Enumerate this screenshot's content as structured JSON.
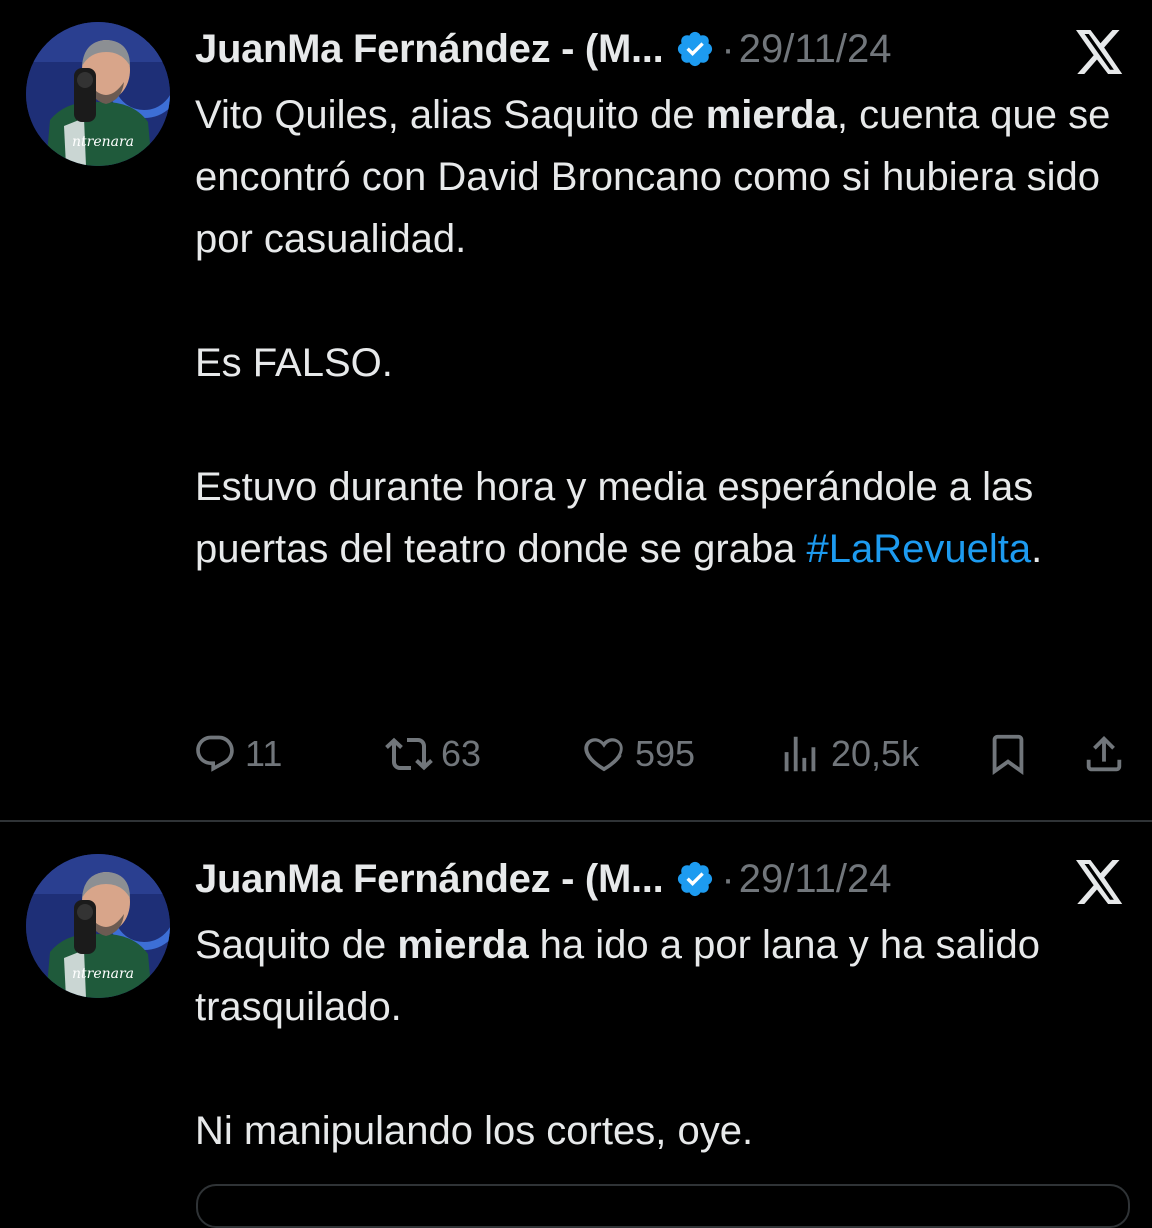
{
  "tweets": [
    {
      "author_name": "JuanMa Fernández - (M...",
      "separator": "·",
      "date": "29/11/24",
      "text": {
        "p1_part1": "Vito Quiles, alias Saquito de ",
        "p1_bold": "mierda",
        "p1_part2": ", cuenta que se encontró con David Broncano como si hubiera sido por casualidad.",
        "p2": "Es FALSO.",
        "p3_part1": "Estuvo durante hora y media esperándole a las puertas del teatro donde se graba ",
        "p3_hashtag": "#LaRevuelta",
        "p3_part2": "."
      },
      "actions": {
        "reply_count": "11",
        "retweet_count": "63",
        "like_count": "595",
        "views_count": "20,5k"
      }
    },
    {
      "author_name": "JuanMa Fernández - (M...",
      "separator": "·",
      "date": "29/11/24",
      "text": {
        "p1_part1": "Saquito de ",
        "p1_bold": "mierda",
        "p1_part2": " ha ido a por lana y ha salido trasquilado.",
        "p2": "Ni manipulando los cortes, oye."
      }
    }
  ],
  "icons": {
    "verified": "verified-badge-icon",
    "x_logo": "x-logo-icon",
    "reply": "reply-icon",
    "retweet": "retweet-icon",
    "like": "heart-icon",
    "views": "views-icon",
    "bookmark": "bookmark-icon",
    "share": "share-icon"
  },
  "colors": {
    "background": "#000000",
    "text": "#e7e9ea",
    "muted": "#71767b",
    "accent": "#1d9bf0",
    "divider": "#2f3336"
  }
}
